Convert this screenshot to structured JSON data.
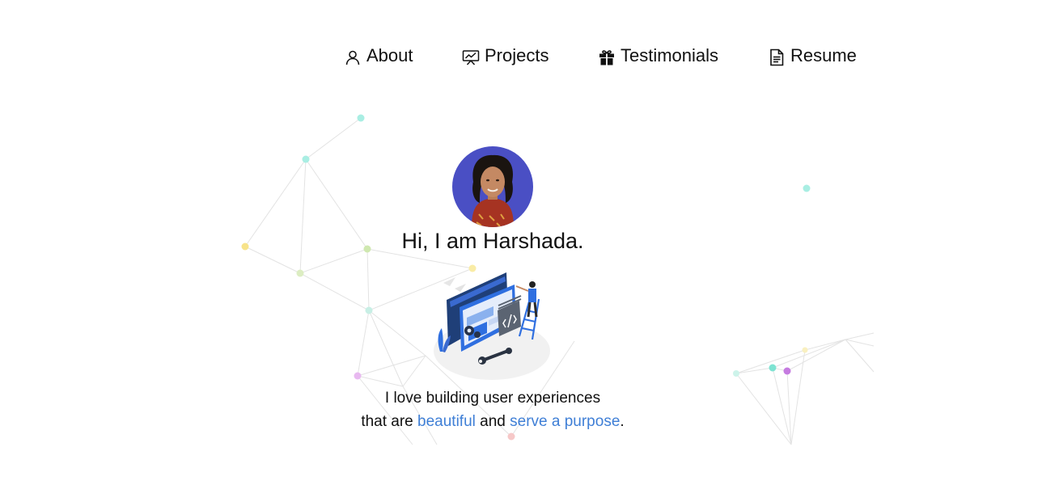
{
  "nav": {
    "items": [
      {
        "label": "About",
        "icon": "user-icon"
      },
      {
        "label": "Projects",
        "icon": "presentation-chart-icon"
      },
      {
        "label": "Testimonials",
        "icon": "gift-icon"
      },
      {
        "label": "Resume",
        "icon": "document-icon"
      }
    ]
  },
  "hero": {
    "greeting": "Hi, I am Harshada.",
    "tagline_line1": "I love building user experiences",
    "tagline_prefix": "that are",
    "highlight1": "beautiful",
    "tagline_and": "and",
    "highlight2": "serve a purpose",
    "tagline_end": "."
  },
  "colors": {
    "accent": "#3f7fd6",
    "text": "#111111",
    "avatar_bg": "#4a4fc4",
    "illustration_blue": "#2f6fe0"
  }
}
